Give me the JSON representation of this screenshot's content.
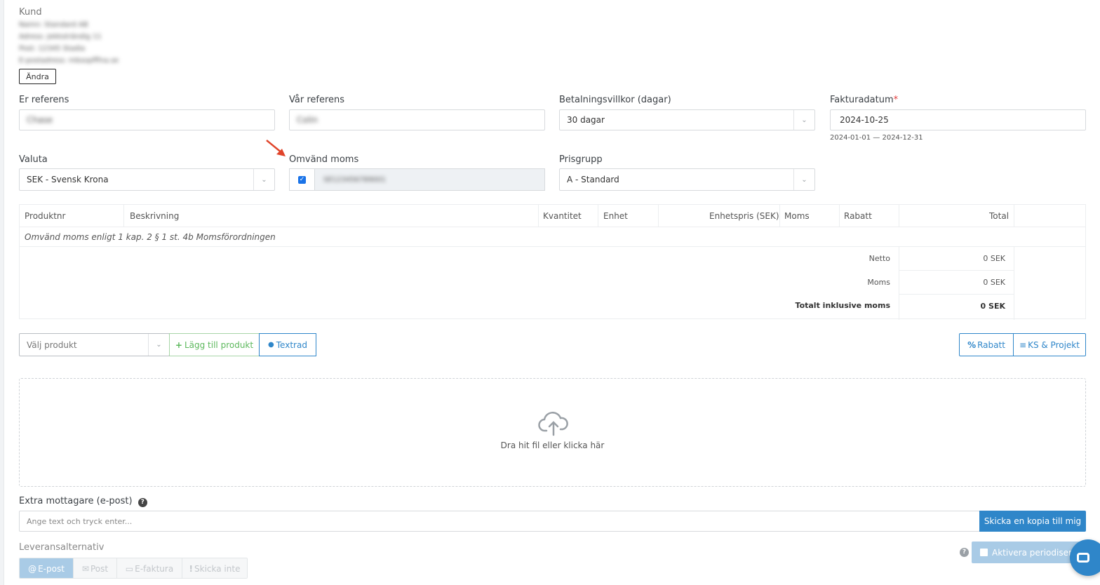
{
  "customer": {
    "title": "Kund",
    "lines": [
      "Namn: Standard AB",
      "Adress: Jekksträndig 11",
      "Post: 12345 Stadia",
      "E-postadress: mbsopfffna.se"
    ],
    "change_button": "Ändra"
  },
  "fields": {
    "er_referens": {
      "label": "Er referens",
      "value": "Chase"
    },
    "var_referens": {
      "label": "Vår referens",
      "value": "Colin"
    },
    "betalningsvillkor": {
      "label": "Betalningsvillkor (dagar)",
      "value": "30 dagar"
    },
    "fakturadatum": {
      "label": "Fakturadatum",
      "required_mark": "*",
      "value": "2024-10-25",
      "range": "2024-01-01 — 2024-12-31"
    },
    "valuta": {
      "label": "Valuta",
      "value": "SEK - Svensk Krona"
    },
    "omvand_moms": {
      "label": "Omvänd moms",
      "checked": true,
      "value": "SE123456789001"
    },
    "prisgrupp": {
      "label": "Prisgrupp",
      "value": "A - Standard"
    }
  },
  "table": {
    "headers": {
      "produktnr": "Produktnr",
      "beskrivning": "Beskrivning",
      "kvantitet": "Kvantitet",
      "enhet": "Enhet",
      "enhetspris": "Enhetspris (SEK)",
      "moms": "Moms",
      "rabatt": "Rabatt",
      "total": "Total"
    },
    "note": "Omvänd moms enligt 1 kap. 2 § 1 st. 4b Momsförordningen",
    "summary": {
      "netto_label": "Netto",
      "netto_value": "0 SEK",
      "moms_label": "Moms",
      "moms_value": "0 SEK",
      "total_label": "Totalt inklusive moms",
      "total_value": "0 SEK"
    }
  },
  "actions": {
    "product_placeholder": "Välj produkt",
    "add_product": "Lägg till produkt",
    "textrad": "Textrad",
    "rabatt": "Rabatt",
    "ks_projekt": "KS & Projekt"
  },
  "upload": {
    "text": "Dra hit fil eller klicka här"
  },
  "extra": {
    "label": "Extra mottagare (e-post)",
    "placeholder": "Ange text och tryck enter...",
    "send_copy": "Skicka en kopia till mig"
  },
  "delivery": {
    "label": "Leveransalternativ",
    "options": [
      "E-post",
      "Post",
      "E-faktura",
      "Skicka inte"
    ],
    "periodisering": "Aktivera periodisering"
  },
  "colors": {
    "primary": "#2f86c9",
    "green": "#5cb85c",
    "red_arrow": "#e0442a",
    "required": "#e23b3b"
  }
}
